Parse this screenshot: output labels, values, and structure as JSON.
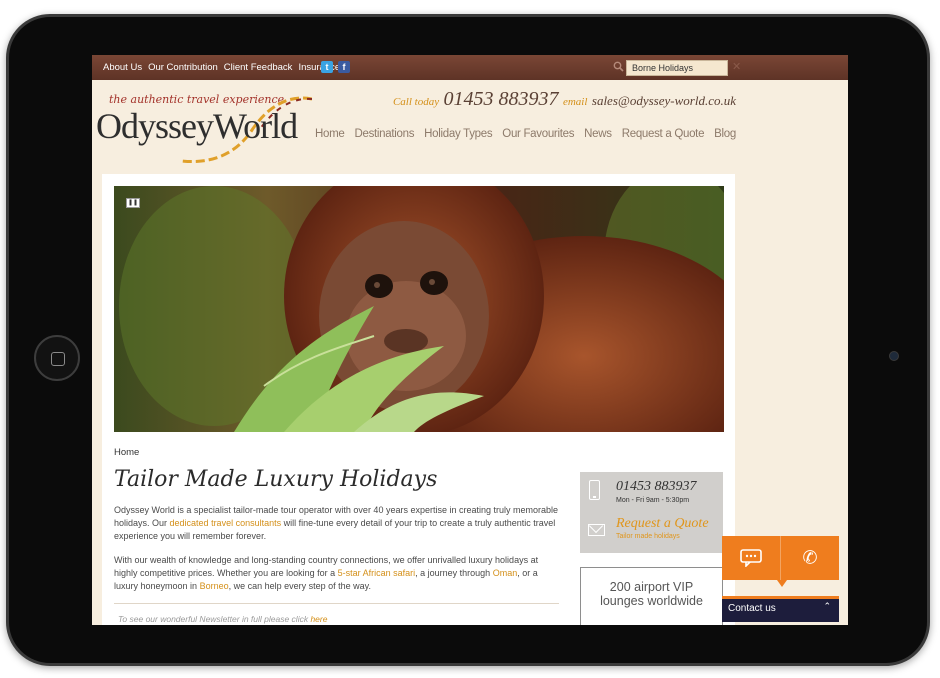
{
  "topbar": {
    "links": [
      "About Us",
      "Our Contribution",
      "Client Feedback",
      "Insurance"
    ],
    "social": {
      "twitter": "t",
      "facebook": "f"
    },
    "search_value": "Borne Holidays",
    "close_glyph": "✕"
  },
  "header": {
    "tagline": "the authentic travel experience",
    "logo": "OdysseyWorld",
    "call_label": "Call today",
    "phone": "01453 883937",
    "email_label": "email",
    "email": "sales@odyssey-world.co.uk"
  },
  "nav": [
    "Home",
    "Destinations",
    "Holiday Types",
    "Our Favourites",
    "News",
    "Request a Quote",
    "Blog"
  ],
  "hero": {
    "pause_glyph": "❚❚"
  },
  "breadcrumb": "Home",
  "page_title": "Tailor Made Luxury Holidays",
  "intro": {
    "p1_a": "Odyssey World is a specialist tailor-made tour operator with over 40 years expertise in creating truly memorable holidays. Our ",
    "p1_link": "dedicated travel consultants",
    "p1_b": " will fine-tune every detail of your trip to create a truly authentic travel experience you will remember forever.",
    "p2_a": "With our wealth of knowledge and long-standing country connections, we offer unrivalled luxury holidays at highly competitive prices. Whether you are looking for a ",
    "p2_link1": "5-star African safari",
    "p2_b": ", a journey through ",
    "p2_link2": "Oman",
    "p2_c": ", or a luxury honeymoon in ",
    "p2_link3": "Borneo",
    "p2_d": ", we can help every step of the way."
  },
  "newsletter": {
    "text": "To see our wonderful Newsletter in full please click ",
    "link": "here"
  },
  "contact_box": {
    "phone": "01453 883937",
    "hours": "Mon - Fri 9am - 5:30pm",
    "quote": "Request a Quote",
    "quote_sub": "Tailor made holidays"
  },
  "vip": {
    "line1": "200 airport VIP",
    "line2": "lounges worldwide"
  },
  "widget": {
    "label": "Contact us",
    "chevron": "⌃",
    "chat_glyph": "☏",
    "phone_glyph": "✆"
  },
  "colors": {
    "topbar": "#6b3a2c",
    "accent": "#d4901a",
    "widget": "#ef7d1e",
    "widget_bar": "#1d1d3c"
  }
}
